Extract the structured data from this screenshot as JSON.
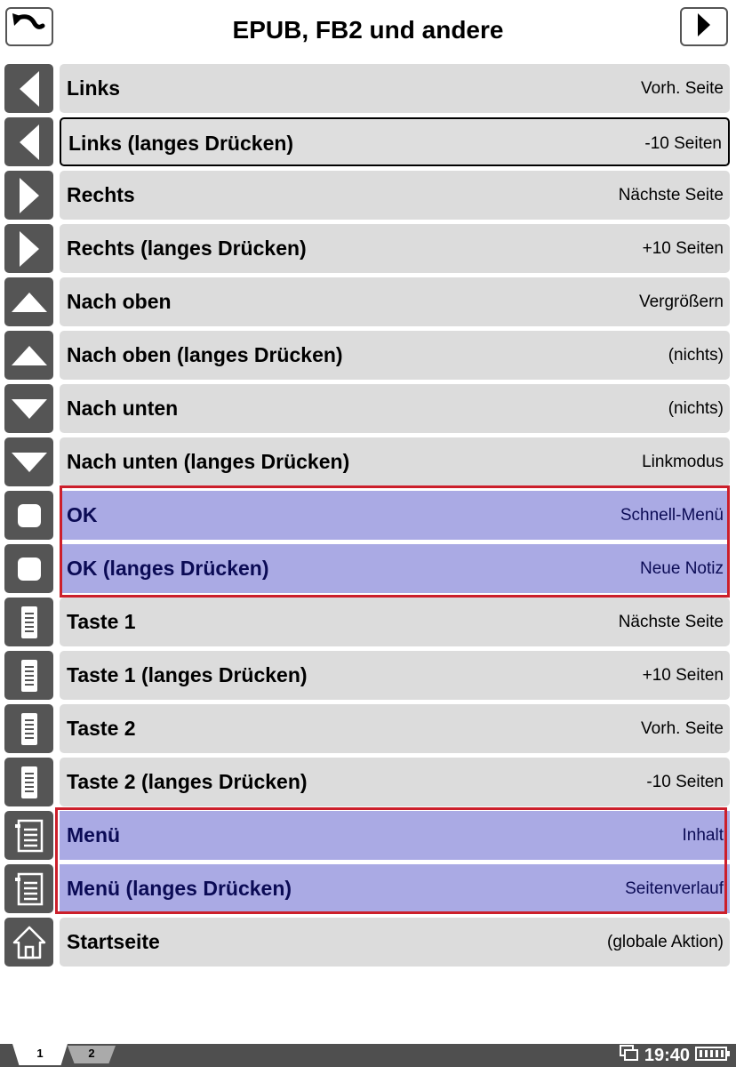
{
  "header": {
    "title": "EPUB, FB2 und andere",
    "back_icon": "back-arrow-icon",
    "next_icon": "next-page-icon"
  },
  "rows": [
    {
      "label": "Links",
      "value": "Vorh. Seite",
      "icon": "arrow-left-icon"
    },
    {
      "label": "Links (langes Drücken)",
      "value": "-10 Seiten",
      "icon": "arrow-left-icon"
    },
    {
      "label": "Rechts",
      "value": "Nächste Seite",
      "icon": "arrow-right-icon"
    },
    {
      "label": "Rechts (langes Drücken)",
      "value": "+10 Seiten",
      "icon": "arrow-right-icon"
    },
    {
      "label": "Nach oben",
      "value": "Vergrößern",
      "icon": "arrow-up-icon"
    },
    {
      "label": "Nach oben (langes Drücken)",
      "value": "(nichts)",
      "icon": "arrow-up-icon"
    },
    {
      "label": "Nach unten",
      "value": "(nichts)",
      "icon": "arrow-down-icon"
    },
    {
      "label": "Nach unten (langes Drücken)",
      "value": "Linkmodus",
      "icon": "arrow-down-icon"
    },
    {
      "label": "OK",
      "value": "Schnell-Menü",
      "icon": "ok-square-icon"
    },
    {
      "label": "OK (langes Drücken)",
      "value": "Neue Notiz",
      "icon": "ok-square-icon"
    },
    {
      "label": "Taste 1",
      "value": "Nächste Seite",
      "icon": "side-key-icon"
    },
    {
      "label": "Taste 1 (langes Drücken)",
      "value": "+10 Seiten",
      "icon": "side-key-icon"
    },
    {
      "label": "Taste 2",
      "value": "Vorh. Seite",
      "icon": "side-key-icon"
    },
    {
      "label": "Taste 2 (langes Drücken)",
      "value": "-10 Seiten",
      "icon": "side-key-icon"
    },
    {
      "label": "Menü",
      "value": "Inhalt",
      "icon": "menu-list-icon"
    },
    {
      "label": "Menü (langes Drücken)",
      "value": "Seitenverlauf",
      "icon": "menu-list-icon"
    },
    {
      "label": "Startseite",
      "value": "(globale Aktion)",
      "icon": "home-icon"
    }
  ],
  "highlighted_rows": [
    8,
    9,
    14,
    15
  ],
  "selected_row": 1,
  "statusbar": {
    "tabs": [
      "1",
      "2"
    ],
    "active_tab": "1",
    "time": "19:40",
    "windows_icon": "windows-icon",
    "battery_icon": "battery-icon"
  },
  "colors": {
    "icon_bg": "#555555",
    "row_bg": "#dcdcdc",
    "highlight_bg": "#aaaae4",
    "highlight_text": "#0b0b55",
    "highlight_frame": "#cc1f2b"
  }
}
